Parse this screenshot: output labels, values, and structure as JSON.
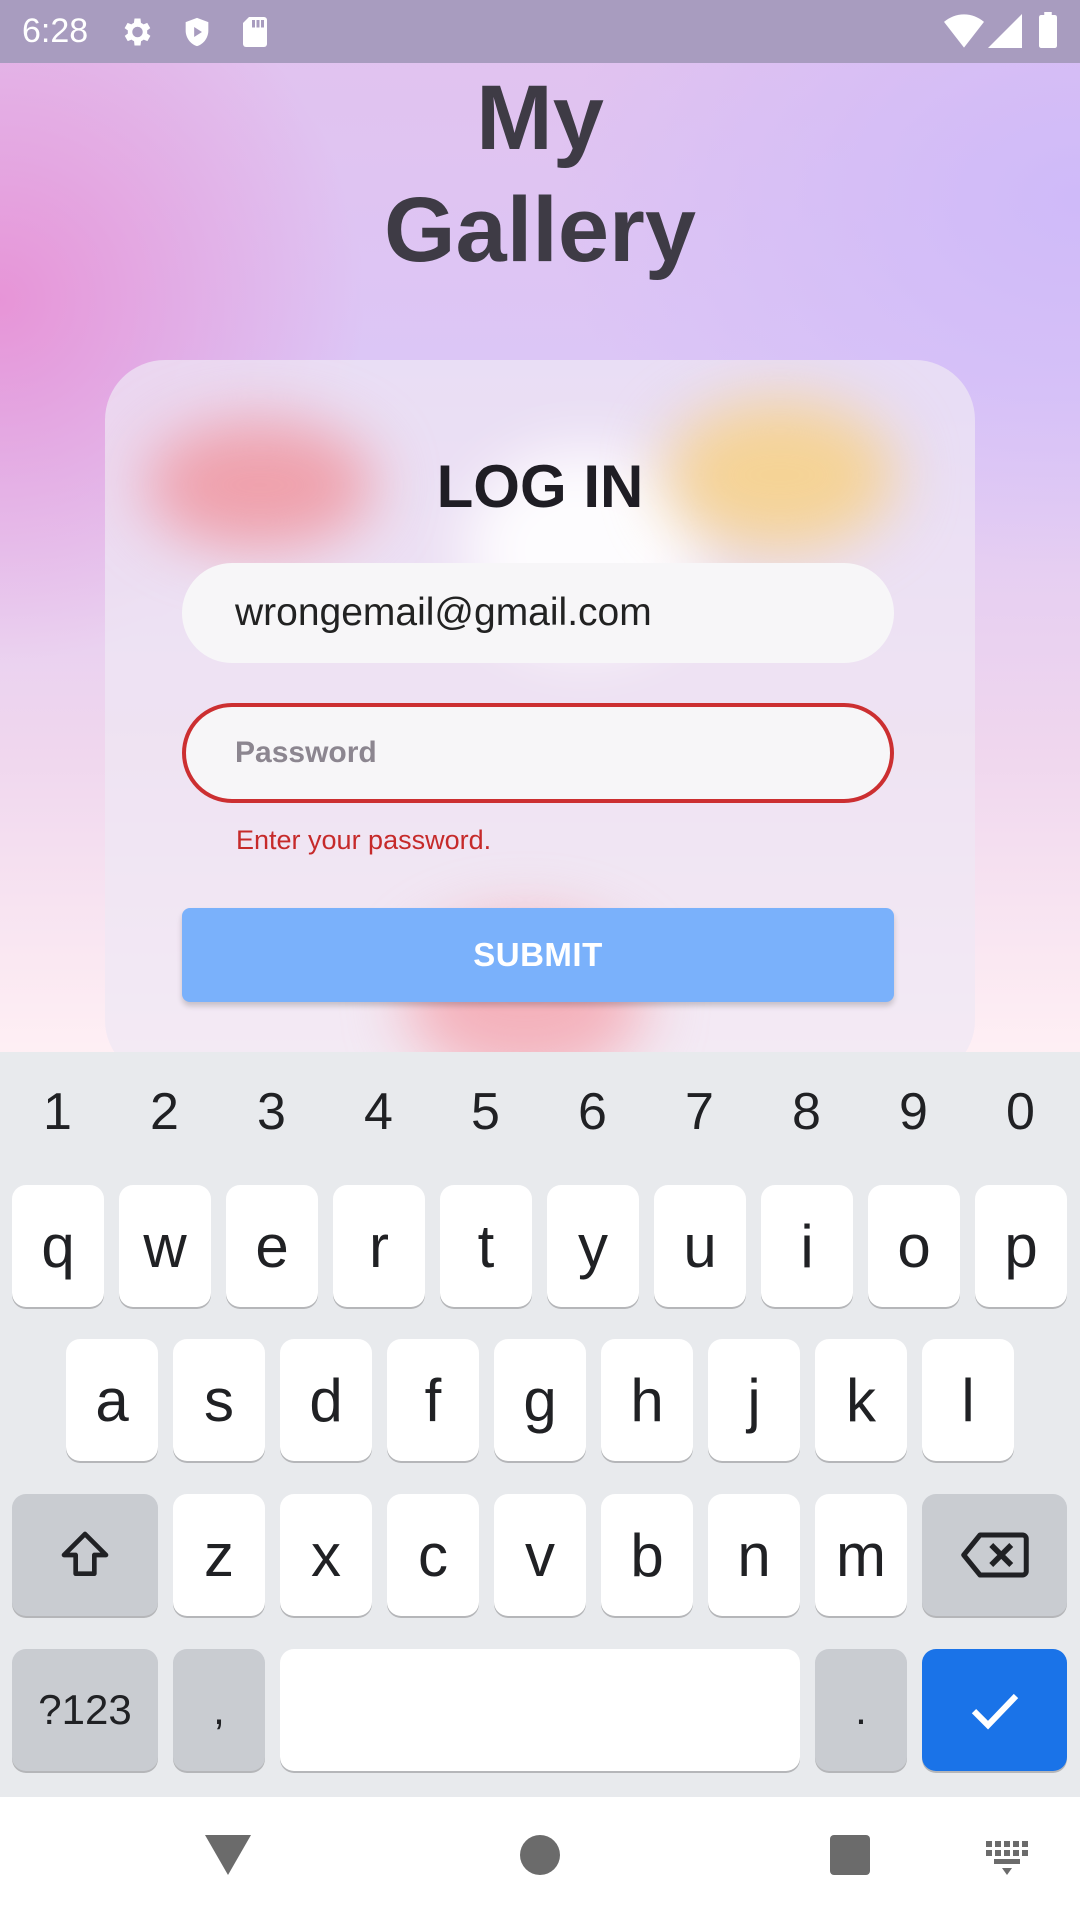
{
  "status_bar": {
    "time": "6:28",
    "left_icons": [
      "settings-icon",
      "shield-play-icon",
      "sd-card-icon"
    ],
    "right_icons": [
      "wifi-icon",
      "signal-icon",
      "battery-icon"
    ]
  },
  "app": {
    "title_line1": "My",
    "title_line2": "Gallery"
  },
  "login_form": {
    "heading": "LOG IN",
    "email_value": "wrongemail@gmail.com",
    "password_value": "",
    "password_placeholder": "Password",
    "password_error": "Enter your password.",
    "submit_label": "SUBMIT",
    "colors": {
      "error": "#cc2f31",
      "submit": "#7ab1fb"
    }
  },
  "keyboard": {
    "number_row": [
      "1",
      "2",
      "3",
      "4",
      "5",
      "6",
      "7",
      "8",
      "9",
      "0"
    ],
    "row1": [
      "q",
      "w",
      "e",
      "r",
      "t",
      "y",
      "u",
      "i",
      "o",
      "p"
    ],
    "row2": [
      "a",
      "s",
      "d",
      "f",
      "g",
      "h",
      "j",
      "k",
      "l"
    ],
    "row3": [
      "z",
      "x",
      "c",
      "v",
      "b",
      "n",
      "m"
    ],
    "symbols_label": "?123",
    "comma_label": ",",
    "period_label": ".",
    "shift_icon": "shift-icon",
    "backspace_icon": "backspace-icon",
    "enter_icon": "checkmark-icon",
    "enter_color": "#1a73e8"
  },
  "nav_bar": {
    "buttons": [
      "back-icon",
      "home-icon",
      "recents-icon",
      "keyboard-switch-icon"
    ]
  }
}
